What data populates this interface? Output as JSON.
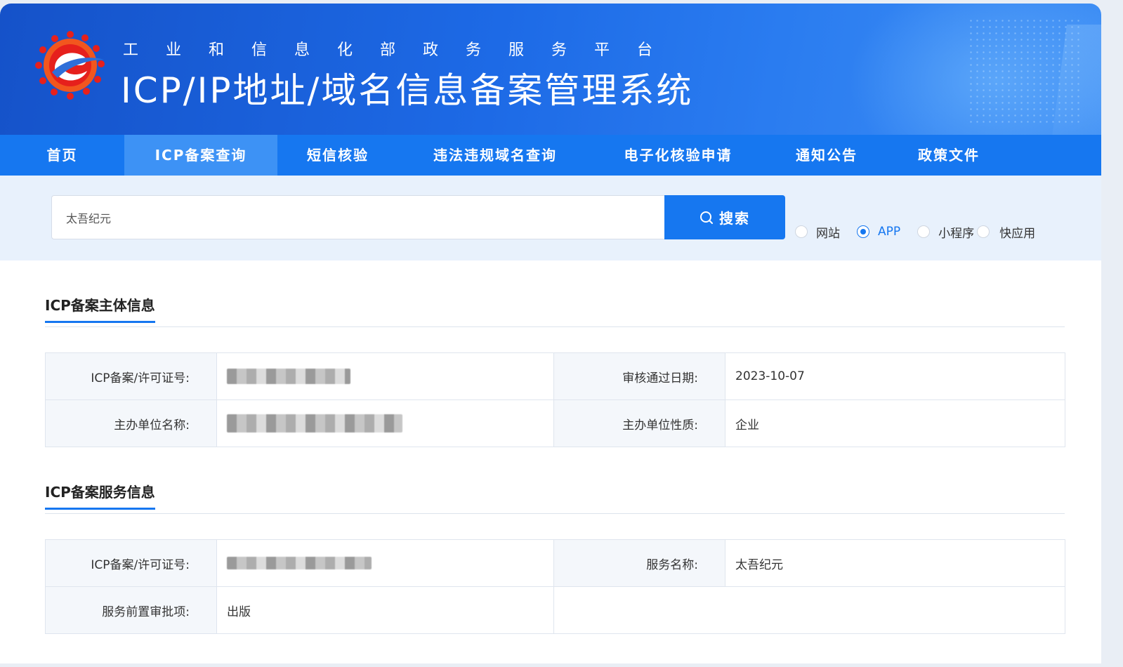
{
  "header": {
    "subtitle": "工业和信息化部政务服务平台",
    "title": "ICP/IP地址/域名信息备案管理系统",
    "colors": {
      "banner": "#1d6ae6",
      "nav": "#1677f0",
      "accent": "#1677f0"
    }
  },
  "nav": {
    "items": [
      {
        "label": "首页"
      },
      {
        "label": "ICP备案查询",
        "active": true
      },
      {
        "label": "短信核验"
      },
      {
        "label": "违法违规域名查询"
      },
      {
        "label": "电子化核验申请"
      },
      {
        "label": "通知公告"
      },
      {
        "label": "政策文件"
      }
    ]
  },
  "search": {
    "value": "太吾纪元",
    "button_label": "搜索",
    "icon": "search-icon",
    "options": [
      {
        "label": "网站",
        "checked": false
      },
      {
        "label": "APP",
        "checked": true
      },
      {
        "label": "小程序",
        "checked": false
      },
      {
        "label": "快应用",
        "checked": false
      }
    ]
  },
  "subject_info": {
    "title": "ICP备案主体信息",
    "rows": [
      {
        "label1": "ICP备案/许可证号:",
        "value1": "",
        "redacted1": true,
        "label2": "审核通过日期:",
        "value2": "2023-10-07"
      },
      {
        "label1": "主办单位名称:",
        "value1": "",
        "redacted1": true,
        "label2": "主办单位性质:",
        "value2": "企业"
      }
    ]
  },
  "service_info": {
    "title": "ICP备案服务信息",
    "rows": [
      {
        "label1": "ICP备案/许可证号:",
        "value1": "",
        "redacted1": true,
        "label2": "服务名称:",
        "value2": "太吾纪元"
      },
      {
        "label1": "服务前置审批项:",
        "value1": "出版",
        "label2": "",
        "value2": ""
      }
    ]
  }
}
